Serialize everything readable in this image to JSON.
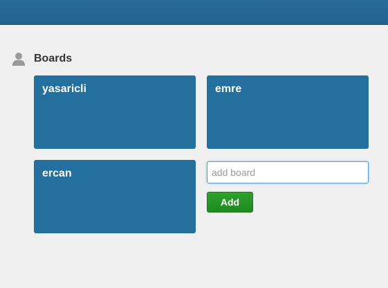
{
  "header": {
    "color": "#23709f"
  },
  "boards_section": {
    "icon": "user-icon",
    "title": "Boards",
    "boards": [
      {
        "name": "yasaricli"
      },
      {
        "name": "emre"
      },
      {
        "name": "ercan"
      }
    ]
  },
  "add_board": {
    "placeholder": "add board",
    "value": "",
    "button_label": "Add",
    "button_color": "#2a9a2a"
  },
  "colors": {
    "board": "#23709f",
    "background": "#f0f0f0"
  }
}
